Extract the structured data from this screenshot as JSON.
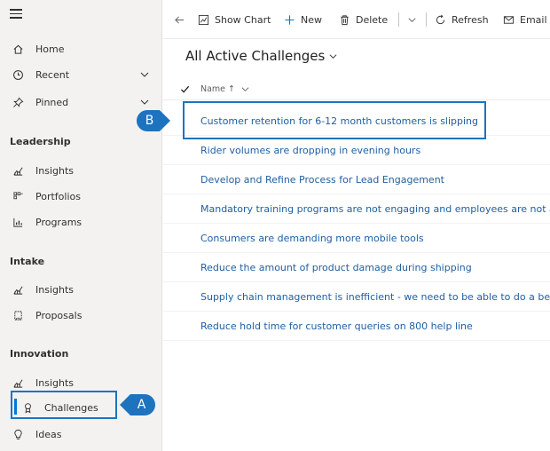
{
  "sidebar": {
    "items_top": [
      {
        "label": "Home",
        "icon": "home-icon"
      },
      {
        "label": "Recent",
        "icon": "clock-icon"
      },
      {
        "label": "Pinned",
        "icon": "pin-icon"
      }
    ],
    "sections": [
      {
        "title": "Leadership",
        "items": [
          {
            "label": "Insights",
            "icon": "insights-icon"
          },
          {
            "label": "Portfolios",
            "icon": "portfolios-icon"
          },
          {
            "label": "Programs",
            "icon": "programs-icon"
          }
        ]
      },
      {
        "title": "Intake",
        "items": [
          {
            "label": "Insights",
            "icon": "insights-icon"
          },
          {
            "label": "Proposals",
            "icon": "proposals-icon"
          }
        ]
      },
      {
        "title": "Innovation",
        "items": [
          {
            "label": "Insights",
            "icon": "insights-icon"
          },
          {
            "label": "Challenges",
            "icon": "challenges-icon",
            "active": true
          },
          {
            "label": "Ideas",
            "icon": "lightbulb-icon"
          }
        ]
      }
    ]
  },
  "commandbar": {
    "show_chart": "Show Chart",
    "new": "New",
    "delete": "Delete",
    "refresh": "Refresh",
    "email": "Email a"
  },
  "view": {
    "title": "All Active Challenges",
    "column_name": "Name ↑"
  },
  "rows": [
    "Customer retention for 6-12 month customers is slipping",
    "Rider volumes are dropping in evening hours",
    "Develop and Refine Process for Lead Engagement",
    "Mandatory training programs are not engaging and employees are not active",
    "Consumers are demanding more mobile tools",
    "Reduce the amount of product damage during shipping",
    "Supply chain management is inefficient - we need to be able to do a better jo",
    "Reduce hold time for customer queries on 800 help line"
  ],
  "callouts": {
    "a": "A",
    "b": "B"
  },
  "colors": {
    "accent": "#0078d4",
    "callout": "#1e73be",
    "link": "#1f5fa3"
  }
}
